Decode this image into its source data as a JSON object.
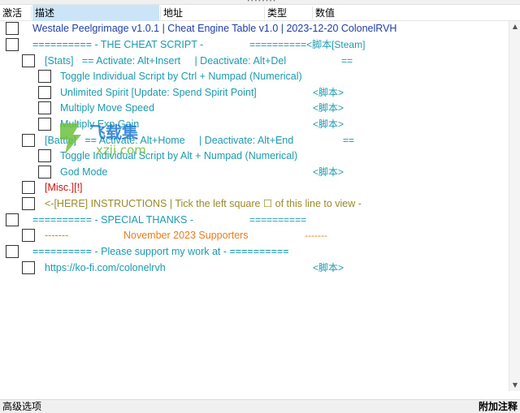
{
  "header": {
    "col_active": "激活",
    "col_desc": "描述",
    "col_address": "地址",
    "col_type": "类型",
    "col_value": "数值"
  },
  "rows": [
    {
      "desc": "Westale Peelgrimage v1.0.1 | Cheat Engine Table v1.0 | 2023-12-20 ColonelRVH",
      "value": ""
    },
    {
      "desc": "========== - THE CHEAT SCRIPT -",
      "value": "==========<脚本[Steam]"
    },
    {
      "desc": "[Stats]   == Activate: Alt+Insert     | Deactivate: Alt+Del",
      "value": "=="
    },
    {
      "desc": "Toggle Individual Script by Ctrl + Numpad (Numerical)",
      "value": ""
    },
    {
      "desc": "Unlimited Spirit [Update: Spend Spirit Point]",
      "value": "<脚本>"
    },
    {
      "desc": "Multiply Move Speed",
      "value": "<脚本>"
    },
    {
      "desc": "Multiply Exp Gain",
      "value": "<脚本>"
    },
    {
      "desc": "[Battle]   == Activate: Alt+Home     | Deactivate: Alt+End",
      "value": "=="
    },
    {
      "desc": "Toggle Individual Script by Alt + Numpad (Numerical)",
      "value": ""
    },
    {
      "desc": "God Mode",
      "value": "<脚本>"
    },
    {
      "desc": "[Misc.][!]",
      "value": ""
    },
    {
      "desc": "<-[HERE] INSTRUCTIONS | Tick the left square ☐ of this line to view -",
      "value": ""
    },
    {
      "desc": "========== - SPECIAL THANKS -",
      "value": "=========="
    },
    {
      "desc": "-------",
      "mid": "November 2023 Supporters",
      "value": "-------"
    },
    {
      "desc": "========== - Please support my work at - ==========",
      "value": ""
    },
    {
      "desc": "https://ko-fi.com/colonelrvh",
      "value": "<脚本>"
    }
  ],
  "watermark": {
    "brand": "飞载集",
    "domain": "xzji.com"
  },
  "footer": {
    "left": "高级选项",
    "right": "附加注释"
  },
  "colors": {
    "navy": "#1f3ea8",
    "teal": "#1c9ab0",
    "red": "#d01010",
    "olive": "#9a8a2a",
    "orange": "#f07a1a",
    "header_highlight": "#cce4f7"
  }
}
